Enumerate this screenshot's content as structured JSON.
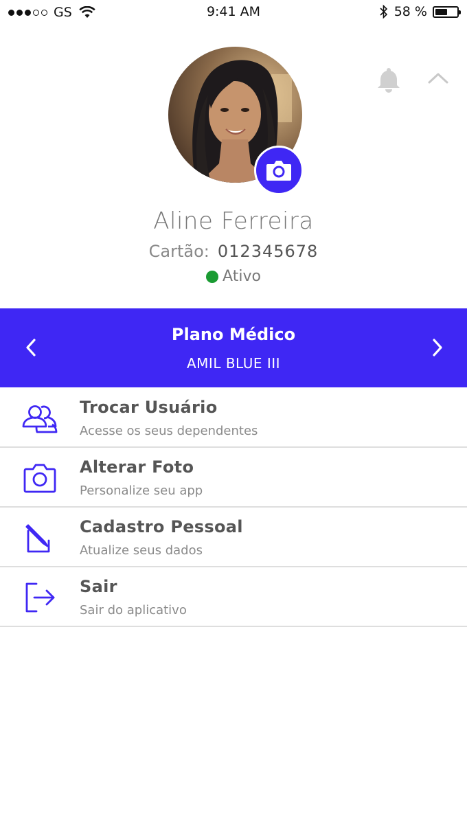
{
  "status_bar": {
    "carrier": "GS",
    "time": "9:41 AM",
    "battery": "58 %",
    "battery_level": 0.58,
    "signal_filled": 3,
    "signal_total": 5
  },
  "profile": {
    "name": "Aline Ferreira",
    "card_label": "Cartão:",
    "card_number": "012345678",
    "status": "Ativo",
    "status_color": "#1a9b32"
  },
  "plan": {
    "title": "Plano Médico",
    "name": "AMIL BLUE III",
    "color": "#3f27f4"
  },
  "menu": [
    {
      "title": "Trocar Usuário",
      "subtitle": "Acesse os seus dependentes",
      "icon": "users-icon"
    },
    {
      "title": "Alterar Foto",
      "subtitle": "Personalize seu app",
      "icon": "camera-icon"
    },
    {
      "title": "Cadastro Pessoal",
      "subtitle": "Atualize seus dados",
      "icon": "edit-icon"
    },
    {
      "title": "Sair",
      "subtitle": "Sair do aplicativo",
      "icon": "logout-icon"
    }
  ]
}
